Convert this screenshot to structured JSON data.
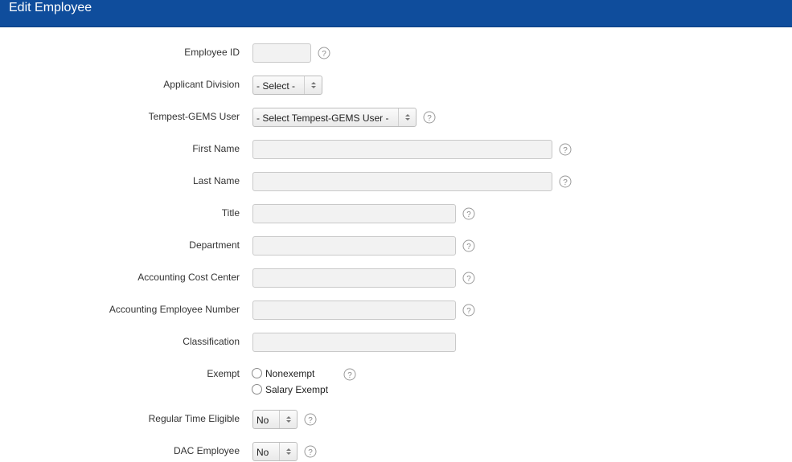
{
  "header": {
    "title": "Edit Employee"
  },
  "form": {
    "employee_id": {
      "label": "Employee ID",
      "value": ""
    },
    "applicant_division": {
      "label": "Applicant Division",
      "selected": "- Select -"
    },
    "tempest_user": {
      "label": "Tempest-GEMS User",
      "selected": "- Select Tempest-GEMS User -"
    },
    "first_name": {
      "label": "First Name",
      "value": ""
    },
    "last_name": {
      "label": "Last Name",
      "value": ""
    },
    "title": {
      "label": "Title",
      "value": ""
    },
    "department": {
      "label": "Department",
      "value": ""
    },
    "cost_center": {
      "label": "Accounting Cost Center",
      "value": ""
    },
    "employee_number": {
      "label": "Accounting Employee Number",
      "value": ""
    },
    "classification": {
      "label": "Classification",
      "value": ""
    },
    "exempt": {
      "label": "Exempt",
      "options": [
        "Nonexempt",
        "Salary Exempt"
      ]
    },
    "regular_time": {
      "label": "Regular Time Eligible",
      "selected": "No"
    },
    "dac_employee": {
      "label": "DAC Employee",
      "selected": "No"
    }
  },
  "icons": {
    "help": "help-question-icon",
    "select_arrow": "select-updown-arrow-icon"
  },
  "colors": {
    "header_bg": "#0f4d9c",
    "input_bg": "#f2f2f2"
  }
}
